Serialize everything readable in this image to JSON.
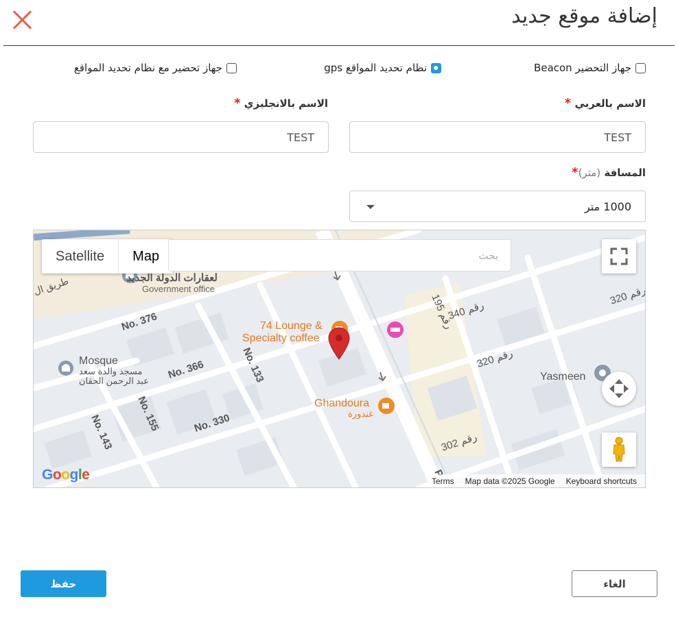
{
  "dialog": {
    "title": "إضافة موقع جديد"
  },
  "device_options": [
    {
      "label": "جهاز التحضير Beacon",
      "checked": false
    },
    {
      "label": "نظام تحديد المواقع gps",
      "checked": true
    },
    {
      "label": "جهاز تحضير مع نظام تحديد المواقع",
      "checked": false
    }
  ],
  "form": {
    "name_ar": {
      "label": "الاسم بالعربي",
      "required": "*",
      "value": "TEST"
    },
    "name_en": {
      "label": "الاسم بالانجليزي",
      "required": "*",
      "value": "TEST"
    },
    "distance": {
      "label": "المسافة",
      "unit_label": "(متر)",
      "required": "*",
      "value": "1000 متر"
    }
  },
  "map": {
    "type_options": [
      "Satellite",
      "Map"
    ],
    "active_type": "Map",
    "search_placeholder": "بحث",
    "attribution": {
      "terms": "Terms",
      "data": "Map data ©2025 Google",
      "shortcuts": "Keyboard shortcuts"
    },
    "logo": "Google",
    "labels": {
      "government_ar": "لعقارات الدولة الجديد",
      "government_en": "Government office",
      "lounge_1": "74 Lounge &",
      "lounge_2": "Specialty coffee",
      "mosque_en": "Mosque",
      "mosque_ar_1": "مسجد والدة سعد",
      "mosque_ar_2": "عبد الرحمن الحقان",
      "ghandoura_en": "Ghandoura",
      "ghandoura_ar": "غندورة",
      "yasmeen": "Yasmeen",
      "road_ar": "طريق ال",
      "no376": "No. 376",
      "no366": "No. 366",
      "no330": "No. 330",
      "no133": "No. 133",
      "no155": "No. 155",
      "no143": "No. 143",
      "r340": "رقم 340",
      "r320a": "رقم 320",
      "r320b": "رقم 320",
      "r302": "رقم 302",
      "r195": "رقم 195",
      "p": "P"
    }
  },
  "actions": {
    "save": "حفظ",
    "cancel": "الغاء"
  },
  "colors": {
    "primary": "#1e9ae0",
    "close": "#e8604c",
    "required": "#e02020",
    "pin": "#d62c2c",
    "poi_orange": "#f08a24",
    "poi_pink": "#e94bb0"
  }
}
